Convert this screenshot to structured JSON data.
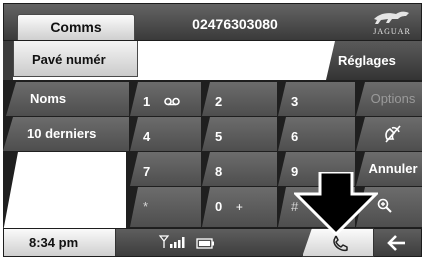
{
  "header": {
    "tab_label": "Comms",
    "phone_number": "02476303080",
    "logo_text": "JAGUAR"
  },
  "row2": {
    "keypad_tab_label": "Pavé numér",
    "settings_label": "Réglages"
  },
  "left_menu": {
    "items": [
      {
        "label": "Noms"
      },
      {
        "label": "10 derniers"
      }
    ]
  },
  "keypad": {
    "keys": [
      {
        "label": "1",
        "sub": "oo"
      },
      {
        "label": "2",
        "sub": ""
      },
      {
        "label": "3",
        "sub": ""
      },
      {
        "label": "4",
        "sub": ""
      },
      {
        "label": "5",
        "sub": ""
      },
      {
        "label": "6",
        "sub": ""
      },
      {
        "label": "7",
        "sub": ""
      },
      {
        "label": "8",
        "sub": ""
      },
      {
        "label": "9",
        "sub": ""
      },
      {
        "label": "*",
        "sub": ""
      },
      {
        "label": "0",
        "sub": "+"
      },
      {
        "label": "#",
        "sub": ""
      }
    ]
  },
  "right_menu": {
    "options_label": "Options",
    "mute_icon": "microphone-mute-icon",
    "cancel_label": "Annuler",
    "zoom_icon": "magnifier-plus-icon"
  },
  "status_bar": {
    "time": "8:34 pm",
    "signal_icon": "signal-strength-icon",
    "battery_icon": "battery-icon",
    "call_icon": "phone-handset-icon",
    "back_icon": "back-arrow-icon"
  },
  "colors": {
    "panel_dark": "#4e4e4e",
    "tab_light": "#e6e6e6",
    "callout": "#000000"
  }
}
